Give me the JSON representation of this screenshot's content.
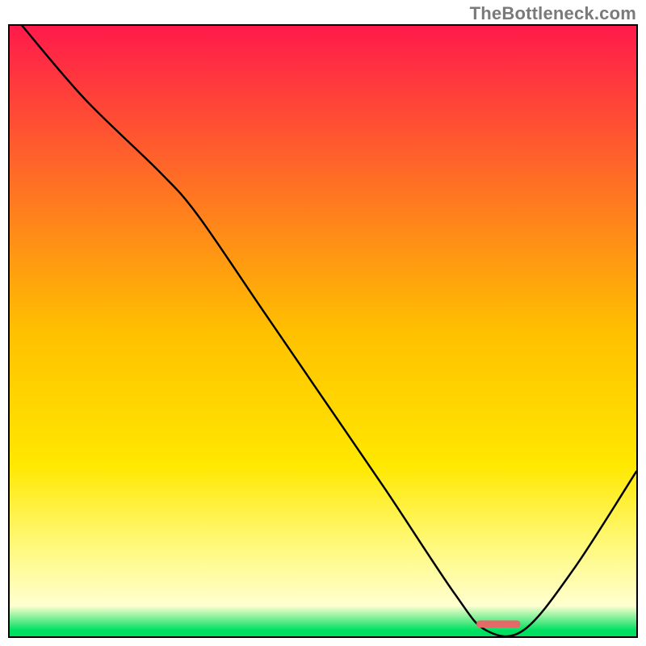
{
  "attribution": "TheBottleneck.com",
  "chart_data": {
    "type": "line",
    "title": "",
    "xlabel": "",
    "ylabel": "",
    "xlim": [
      0,
      100
    ],
    "ylim": [
      0,
      100
    ],
    "x": [
      2,
      12,
      24,
      30,
      40,
      50,
      60,
      71,
      76,
      82,
      90,
      100
    ],
    "y": [
      100,
      88,
      76,
      69,
      54,
      39,
      24,
      7,
      1,
      1,
      11,
      27
    ],
    "gradient_stops": [
      {
        "offset": 0.0,
        "color": "#ff1a4b"
      },
      {
        "offset": 0.5,
        "color": "#ffc000"
      },
      {
        "offset": 0.72,
        "color": "#ffe800"
      },
      {
        "offset": 0.85,
        "color": "#fff97a"
      },
      {
        "offset": 0.95,
        "color": "#ffffd0"
      },
      {
        "offset": 0.99,
        "color": "#00e060"
      }
    ],
    "marker": {
      "x": 78,
      "y": 2,
      "width": 7,
      "height": 1.2,
      "color": "#e46a6a"
    }
  }
}
